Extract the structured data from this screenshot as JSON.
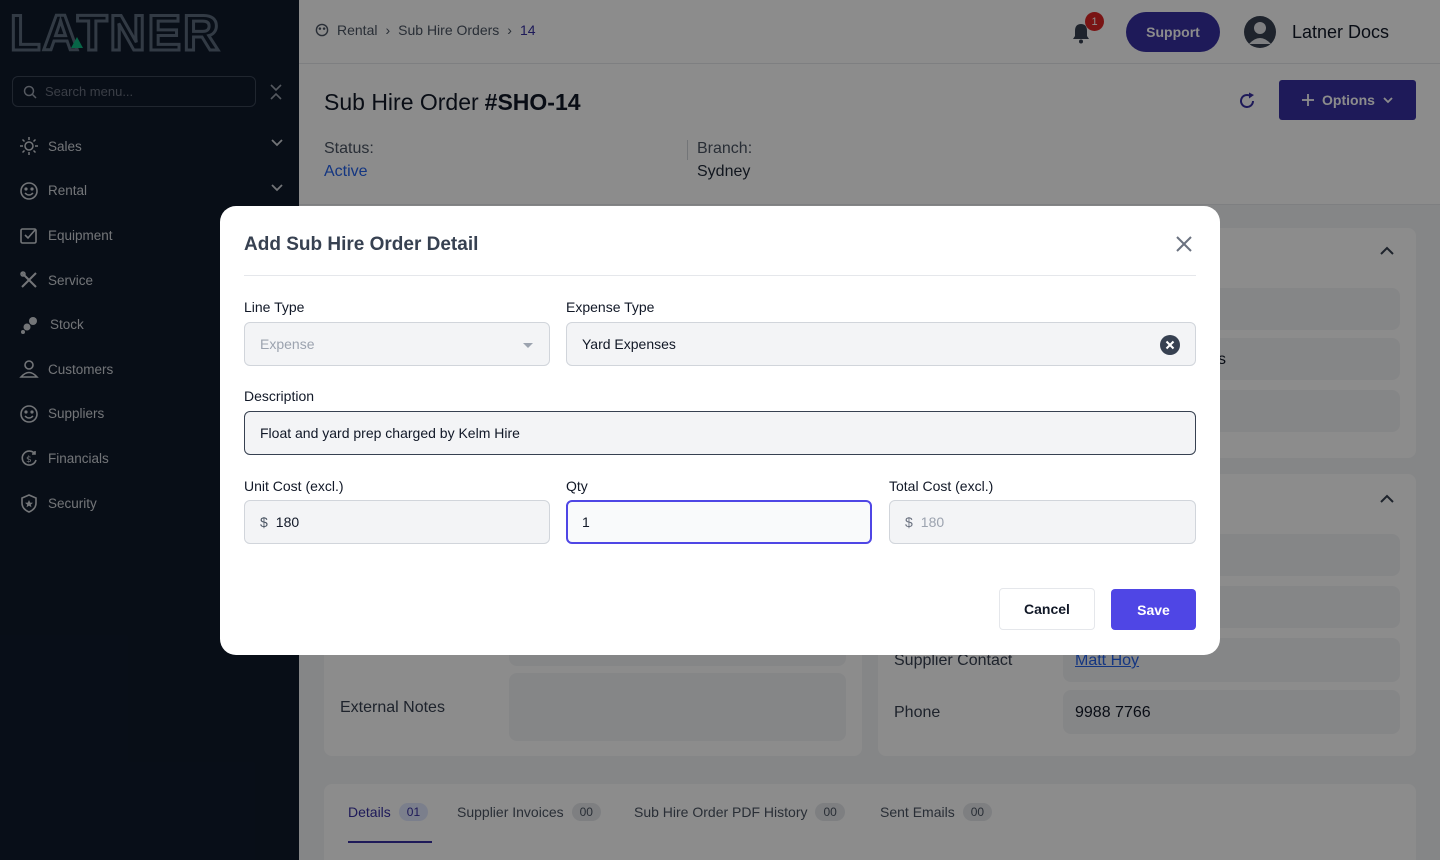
{
  "brand": {
    "logo_text": "LATNER"
  },
  "sidebar": {
    "search_placeholder": "Search menu...",
    "items": [
      {
        "label": "Sales",
        "icon": "sales-icon",
        "expandable": true
      },
      {
        "label": "Rental",
        "icon": "rental-icon",
        "expandable": true
      },
      {
        "label": "Equipment",
        "icon": "equipment-icon",
        "expandable": false
      },
      {
        "label": "Service",
        "icon": "service-icon",
        "expandable": false
      },
      {
        "label": "Stock",
        "icon": "stock-icon",
        "expandable": false
      },
      {
        "label": "Customers",
        "icon": "user-icon",
        "expandable": false
      },
      {
        "label": "Suppliers",
        "icon": "suppliers-icon",
        "expandable": false
      },
      {
        "label": "Financials",
        "icon": "financials-icon",
        "expandable": false
      },
      {
        "label": "Security",
        "icon": "shield-icon",
        "expandable": false
      }
    ]
  },
  "header": {
    "breadcrumbs": [
      "Rental",
      "Sub Hire Orders",
      "14"
    ],
    "notification_count": "1",
    "support_label": "Support",
    "user_name": "Latner Docs"
  },
  "page": {
    "title": "Sub Hire Order",
    "order_number": "#SHO-14",
    "options_label": "Options",
    "status_label": "Status:",
    "status_value": "Active",
    "branch_label": "Branch:",
    "branch_value": "Sydney"
  },
  "background": {
    "external_notes_label": "External Notes",
    "supplier_contact_label": "Supplier Contact",
    "supplier_contact_value": "Matt Hoy",
    "phone_label": "Phone",
    "phone_value": "9988 7766",
    "partial_text": "s"
  },
  "tabs": [
    {
      "label": "Details",
      "count": "01",
      "active": true
    },
    {
      "label": "Supplier Invoices",
      "count": "00",
      "active": false
    },
    {
      "label": "Sub Hire Order PDF History",
      "count": "00",
      "active": false
    },
    {
      "label": "Sent Emails",
      "count": "00",
      "active": false
    }
  ],
  "modal": {
    "title": "Add Sub Hire Order Detail",
    "line_type": {
      "label": "Line Type",
      "value": "Expense"
    },
    "expense_type": {
      "label": "Expense Type",
      "value": "Yard Expenses"
    },
    "description": {
      "label": "Description",
      "value": "Float and yard prep charged by Kelm Hire"
    },
    "unit_cost": {
      "label": "Unit Cost (excl.)",
      "prefix": "$",
      "value": "180"
    },
    "qty": {
      "label": "Qty",
      "value": "1"
    },
    "total_cost": {
      "label": "Total Cost (excl.)",
      "prefix": "$",
      "value": "180"
    },
    "cancel_label": "Cancel",
    "save_label": "Save"
  },
  "colors": {
    "sidebar_bg": "#0f1a2b",
    "primary": "#3730a3",
    "save": "#4f46e5",
    "link": "#2563eb",
    "badge": "#dc2626"
  }
}
